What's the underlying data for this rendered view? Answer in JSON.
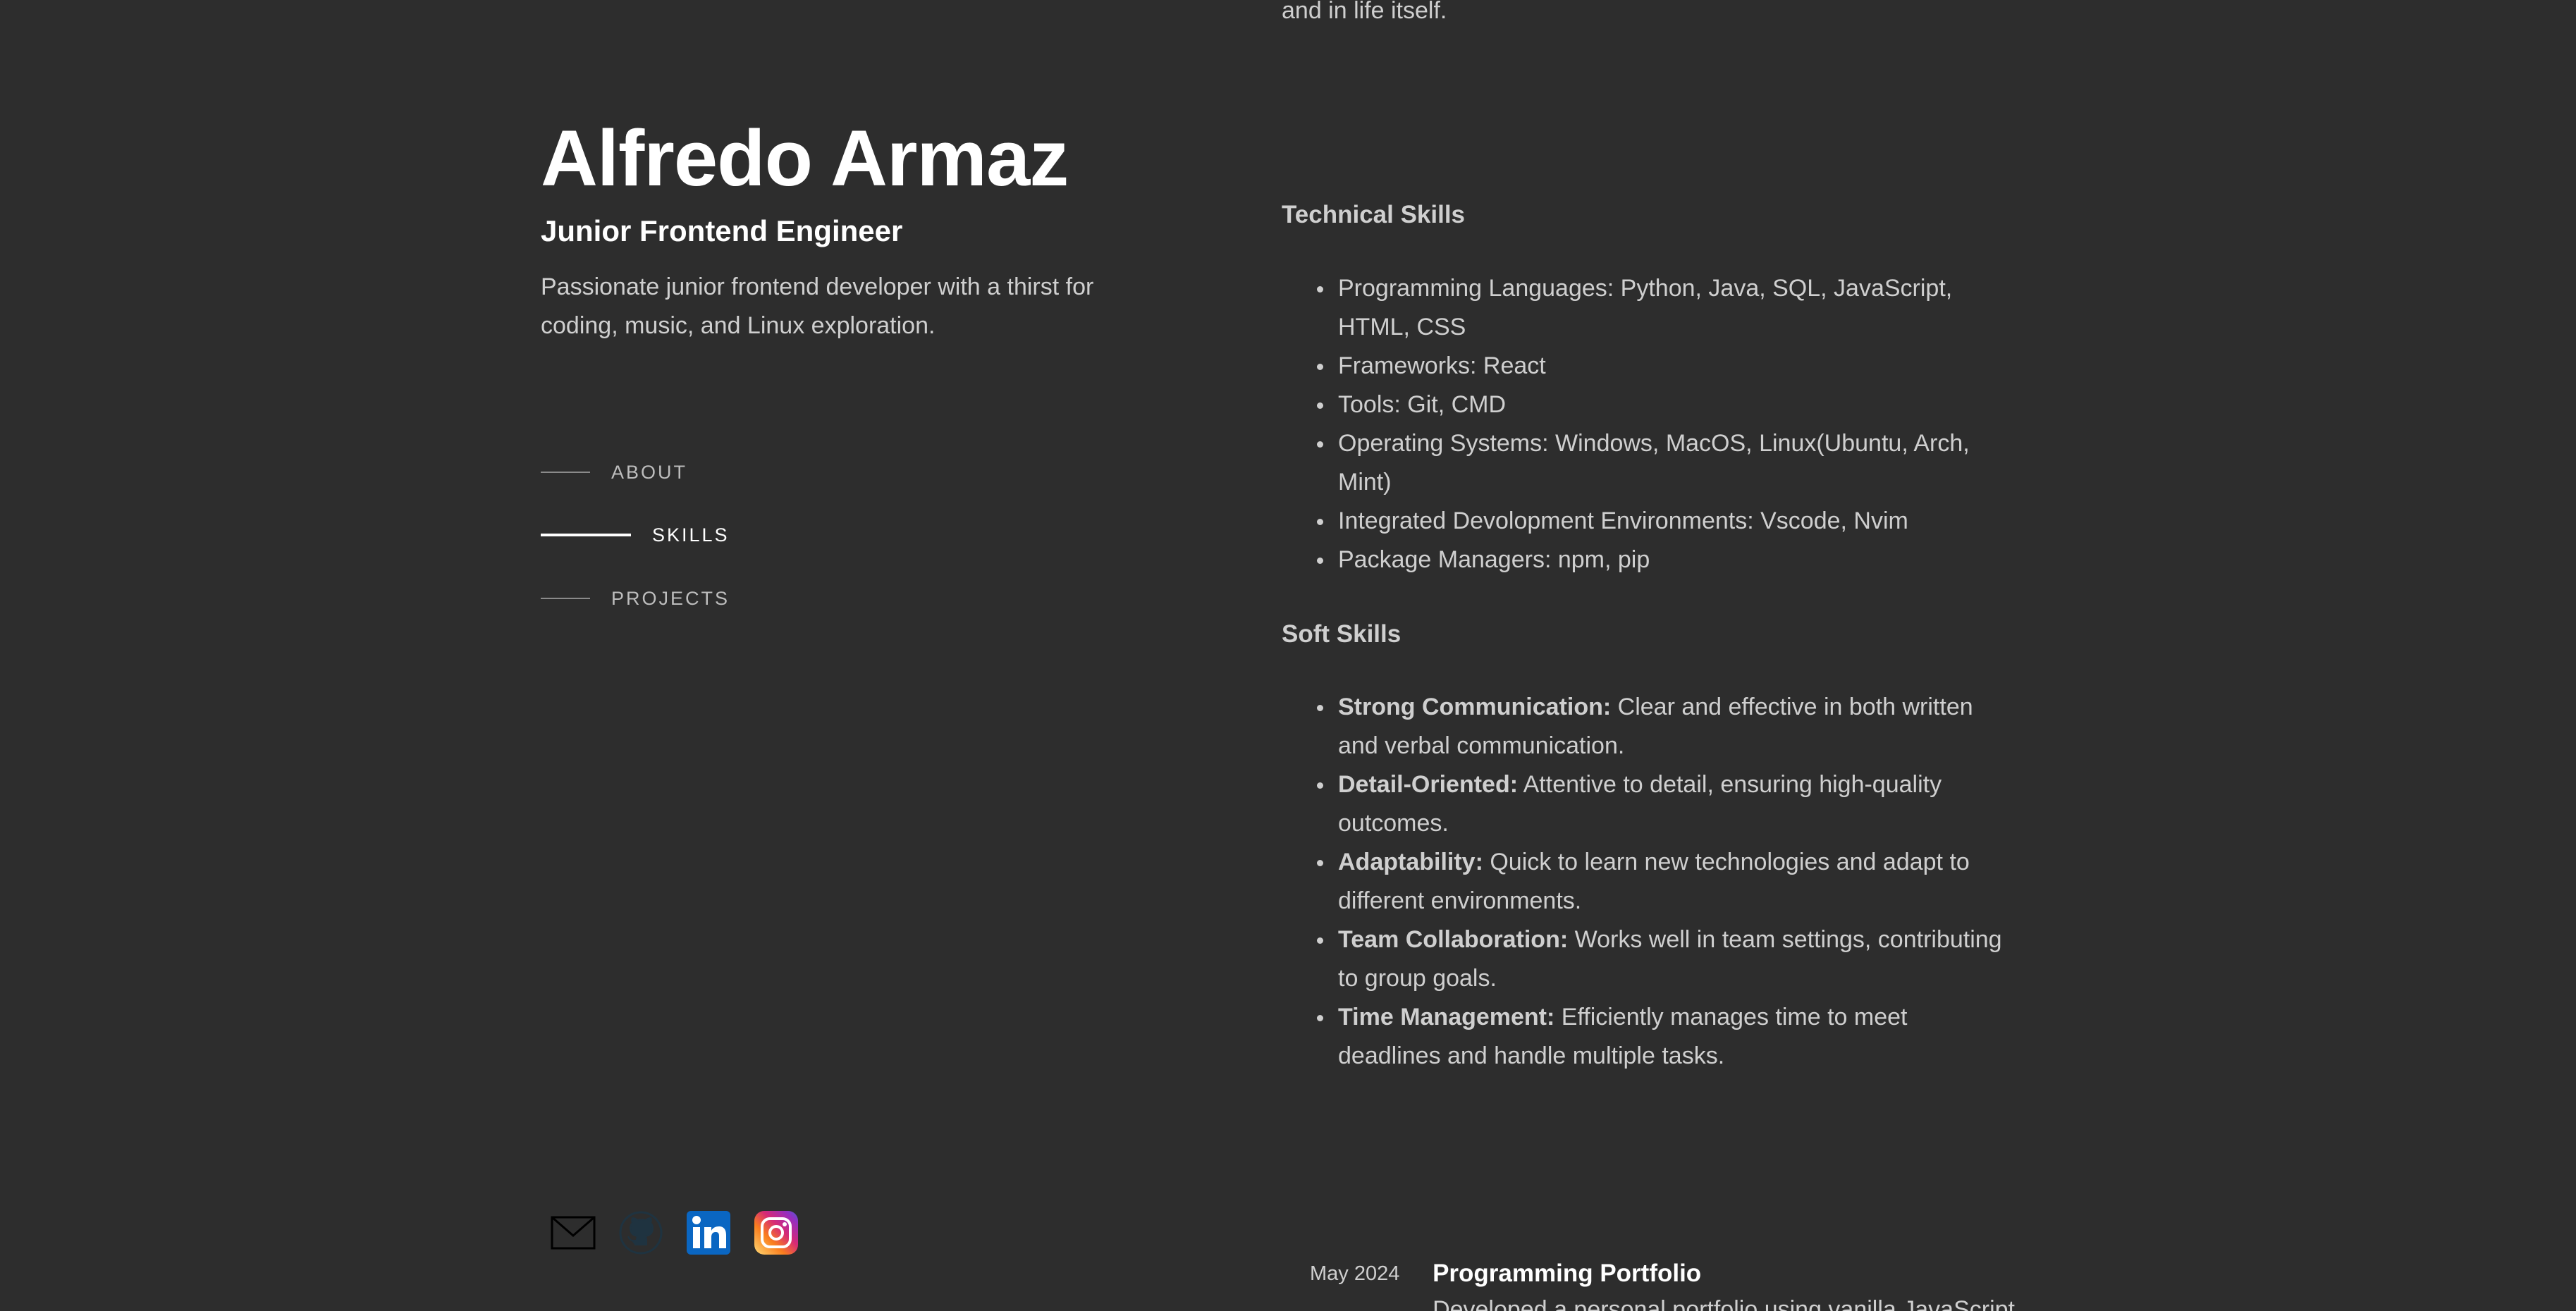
{
  "profile": {
    "name": "Alfredo Armaz",
    "role": "Junior Frontend Engineer",
    "tagline": "Passionate junior frontend developer with a thirst for coding, music, and Linux exploration."
  },
  "nav": {
    "items": [
      {
        "label": "ABOUT",
        "active": false
      },
      {
        "label": "SKILLS",
        "active": true
      },
      {
        "label": "PROJECTS",
        "active": false
      }
    ]
  },
  "social": {
    "icons": [
      "mail-icon",
      "github-icon",
      "linkedin-icon",
      "instagram-icon"
    ]
  },
  "about": {
    "tail": "and in life itself."
  },
  "skills": {
    "technical_title": "Technical Skills",
    "technical": [
      "Programming Languages: Python, Java, SQL, JavaScript, HTML, CSS",
      "Frameworks: React",
      "Tools: Git, CMD",
      "Operating Systems: Windows, MacOS, Linux(Ubuntu, Arch, Mint)",
      "Integrated Devolopment Environments: Vscode, Nvim",
      "Package Managers: npm, pip"
    ],
    "soft_title": "Soft Skills",
    "soft": [
      {
        "label": "Strong Communication:",
        "text": " Clear and effective in both written and verbal communication."
      },
      {
        "label": "Detail-Oriented:",
        "text": " Attentive to detail, ensuring high-quality outcomes."
      },
      {
        "label": "Adaptability:",
        "text": " Quick to learn new technologies and adapt to different environments."
      },
      {
        "label": "Team Collaboration:",
        "text": " Works well in team settings, contributing to group goals."
      },
      {
        "label": "Time Management:",
        "text": " Efficiently manages time to meet deadlines and handle multiple tasks."
      }
    ]
  },
  "projects": [
    {
      "date": "May 2024",
      "title": "Programming Portfolio",
      "description": "Developed a personal portfolio using vanilla JavaScript"
    }
  ],
  "colors": {
    "background": "#2d2d2d",
    "heading": "#ffffff",
    "text": "#cfcfcf",
    "linkedin": "#0a66c2"
  }
}
